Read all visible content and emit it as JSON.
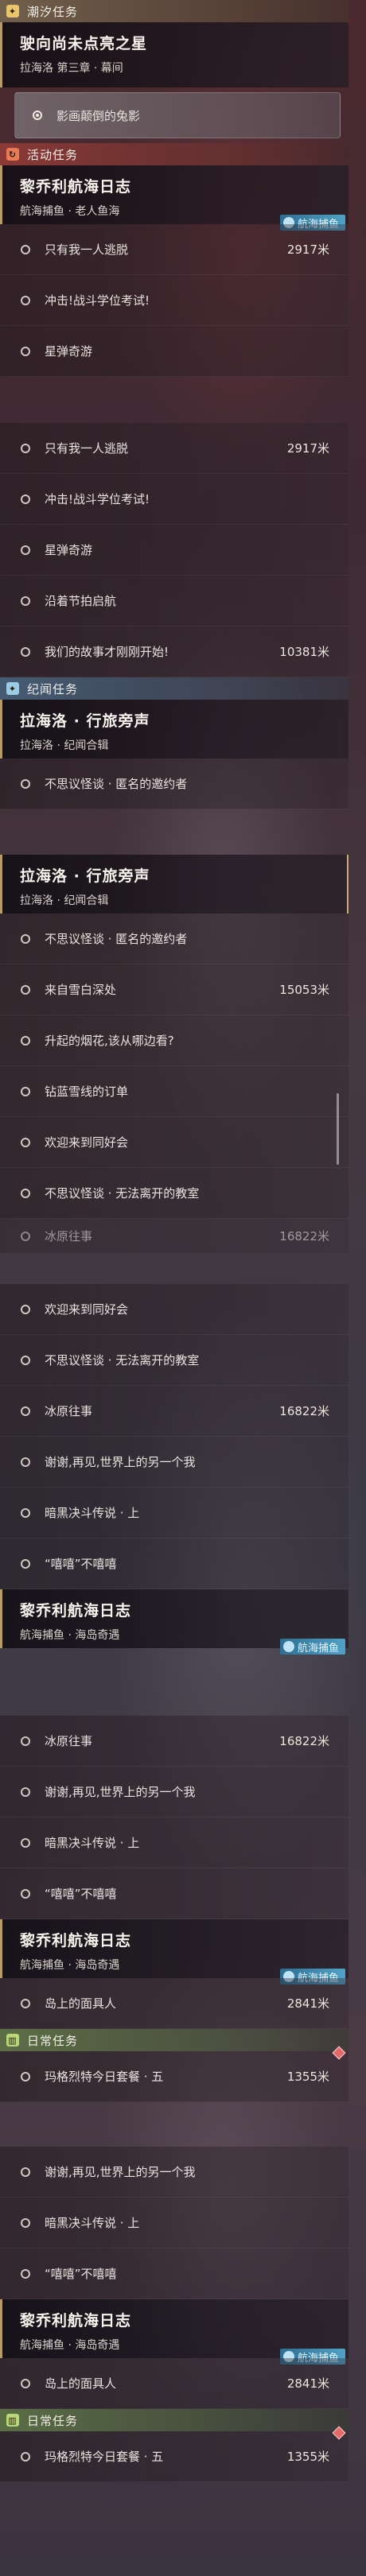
{
  "sections": {
    "chaoxi": "潮汐任务",
    "huodong": "活动任务",
    "jiwen": "纪闻任务",
    "richang": "日常任务"
  },
  "main_quest": {
    "title": "驶向尚未点亮之星",
    "sub": "拉海洛 第三章 · 幕间",
    "selected_item": "影画颠倒的兔影"
  },
  "hanghai_a": {
    "title": "黎乔利航海日志",
    "sub": "航海捕鱼 · 老人鱼海",
    "tag": "航海捕鱼"
  },
  "hanghai_b": {
    "title": "黎乔利航海日志",
    "sub": "航海捕鱼 · 海岛奇遇",
    "tag": "航海捕鱼"
  },
  "lvxing": {
    "title": "拉海洛 · 行旅旁声",
    "sub": "拉海洛 · 纪闻合辑"
  },
  "items": {
    "only_me": "只有我一人逃脱",
    "only_me_dist": "2917米",
    "chongci": "冲击!战斗学位考试!",
    "xingdan": "星弹奇游",
    "yanzhe": "沿着节拍启航",
    "women": "我们的故事才刚刚开始!",
    "women_dist": "10381米",
    "bukesiyi": "不思议怪谈 · 匿名的邀约者",
    "xuebai": "来自雪白深处",
    "xuebai_dist": "15053米",
    "shengqi": "升起的烟花,该从哪边看?",
    "zuanlan": "钻蓝雪线的订单",
    "huanying": "欢迎来到同好会",
    "bukesiyi2": "不思议怪谈 · 无法离开的教室",
    "bingyuan": "冰原往事",
    "bingyuan_dist": "16822米",
    "xiexie": "谢谢,再见,世界上的另一个我",
    "anhei": "暗黑决斗传说 · 上",
    "xixi": "“嘻嘻”不嘻嘻",
    "daoshang": "岛上的面具人",
    "daoshang_dist": "2841米",
    "mate": "玛格烈特今日套餐 · 五",
    "mate_dist": "1355米",
    "bingyuan_partial": "冰原往事",
    "bingyuan_partial_dist": "16822米"
  },
  "colors": {
    "tide": "#e7c56a",
    "event": "#e87a54",
    "chronicle": "#9ccbe6",
    "daily": "#b8d67a",
    "tag": "#4fa2c6"
  },
  "icons": {
    "tide": "star-icon",
    "event": "event-icon",
    "chronicle": "star-icon",
    "daily": "book-icon",
    "tag": "fish-icon"
  }
}
